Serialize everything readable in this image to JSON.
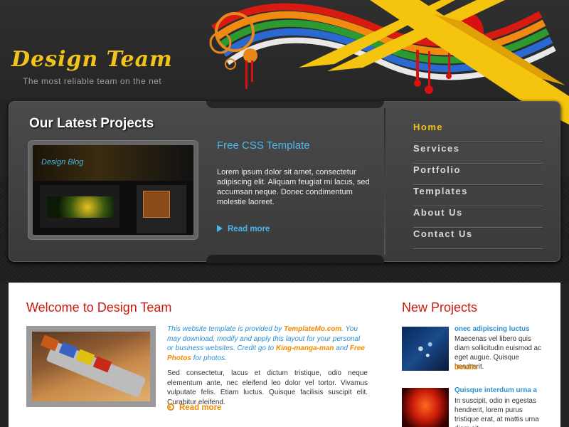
{
  "colors": {
    "accent_yellow": "#f2c31a",
    "accent_blue": "#49b8ef",
    "heading_red": "#cc1a10",
    "link_orange": "#f08a00"
  },
  "header": {
    "logo": "Design Team",
    "tagline": "The most reliable team on the net"
  },
  "latest": {
    "title": "Our Latest Projects",
    "thumb_logo": "Design Blog",
    "project_title": "Free CSS Template",
    "project_text": "Lorem ipsum dolor sit amet, consectetur adipiscing elit. Aliquam feugiat mi lacus, sed accumsan neque. Donec condimentum molestie laoreet.",
    "read_more": "Read more"
  },
  "nav": {
    "items": [
      {
        "label": "Home",
        "active": true
      },
      {
        "label": "Services"
      },
      {
        "label": "Portfolio"
      },
      {
        "label": "Templates"
      },
      {
        "label": "About Us"
      },
      {
        "label": "Contact Us"
      }
    ]
  },
  "welcome": {
    "title": "Welcome to Design Team",
    "intro_1": "This website template is provided by ",
    "intro_link_1": "TemplateMo.com",
    "intro_2": ". You may download, modify and apply this layout for your personal or business websites. Credit go to ",
    "intro_link_2": "King-manga-man",
    "intro_3": " and ",
    "intro_link_3": "Free Photos",
    "intro_4": " for photos.",
    "body": "Sed consectetur, lacus et dictum tristique, odio neque elementum ante, nec eleifend leo dolor vel tortor. Vivamus vulputate felis. Etiam luctus. Quisque facilisis suscipit elit. Curabitur eleifend.",
    "read_more": "Read more"
  },
  "new_projects": {
    "title": "New Projects",
    "items": [
      {
        "title": "onec adipiscing luctus",
        "text": "Maecenas vel libero quis diam sollicitudin euismod ac eget augue. Quisque hendrerit.",
        "details": "Details"
      },
      {
        "title": "Quisque interdum urna a",
        "text": "In suscipit, odio in egestas hendrerit, lorem purus tristique erat, at mattis urna diam sit"
      }
    ]
  }
}
